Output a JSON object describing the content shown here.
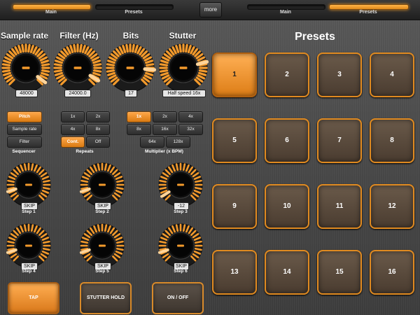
{
  "tabs": {
    "left": [
      {
        "label": "Main",
        "active": true
      },
      {
        "label": "Presets",
        "active": false
      }
    ],
    "more": "more",
    "right": [
      {
        "label": "Main",
        "active": false
      },
      {
        "label": "Presets",
        "active": true
      }
    ]
  },
  "knobs": [
    {
      "title": "Sample rate",
      "value": "48000",
      "level": 0.97
    },
    {
      "title": "Filter (Hz)",
      "value": "24000.0",
      "level": 0.95
    },
    {
      "title": "Bits",
      "value": "17",
      "level": 0.85
    },
    {
      "title": "Stutter",
      "value": "Half speed 16x",
      "level": 0.78
    }
  ],
  "sequencer": {
    "label": "Sequencer",
    "buttons": [
      {
        "label": "Pitch",
        "on": true
      },
      {
        "label": "Sample rate",
        "on": false
      },
      {
        "label": "Filter",
        "on": false
      }
    ]
  },
  "repeats": {
    "label": "Repeats",
    "buttons": [
      {
        "label": "1x",
        "on": false
      },
      {
        "label": "2x",
        "on": false
      },
      {
        "label": "4x",
        "on": false
      },
      {
        "label": "8x",
        "on": false
      },
      {
        "label": "Cont.",
        "on": true
      },
      {
        "label": "Off",
        "on": false
      }
    ]
  },
  "multiplier": {
    "label": "Multiplier (x BPM)",
    "buttons": [
      {
        "label": "1x",
        "on": true
      },
      {
        "label": "2x",
        "on": false
      },
      {
        "label": "4x",
        "on": false
      },
      {
        "label": "8x",
        "on": false
      },
      {
        "label": "16x",
        "on": false
      },
      {
        "label": "32x",
        "on": false
      },
      {
        "label": "64x",
        "on": false
      },
      {
        "label": "128x",
        "on": false
      }
    ]
  },
  "steps": [
    {
      "label": "Step 1",
      "value": "SKIP",
      "level": 0.1
    },
    {
      "label": "Step 2",
      "value": "SKIP",
      "level": 0.1
    },
    {
      "label": "Step 3",
      "value": "-12",
      "level": 0.05
    },
    {
      "label": "Step 4",
      "value": "SKIP",
      "level": 0.1
    },
    {
      "label": "Step 5",
      "value": "SKIP",
      "level": 0.1
    },
    {
      "label": "Step 6",
      "value": "SKIP",
      "level": 0.1
    }
  ],
  "bottom": [
    {
      "label": "TAP",
      "on": true
    },
    {
      "label": "STUTTER HOLD",
      "on": false
    },
    {
      "label": "ON / OFF",
      "on": false
    }
  ],
  "presets": {
    "title": "Presets",
    "pads": [
      {
        "label": "1",
        "on": true
      },
      {
        "label": "2"
      },
      {
        "label": "3"
      },
      {
        "label": "4"
      },
      {
        "label": "5"
      },
      {
        "label": "6"
      },
      {
        "label": "7"
      },
      {
        "label": "8"
      },
      {
        "label": "9"
      },
      {
        "label": "10"
      },
      {
        "label": "11"
      },
      {
        "label": "12"
      },
      {
        "label": "13"
      },
      {
        "label": "14"
      },
      {
        "label": "15"
      },
      {
        "label": "16"
      }
    ]
  },
  "colors": {
    "accent": "#e8891f",
    "accent_light": "#ffb04d",
    "panel": "#4a4a4a"
  }
}
